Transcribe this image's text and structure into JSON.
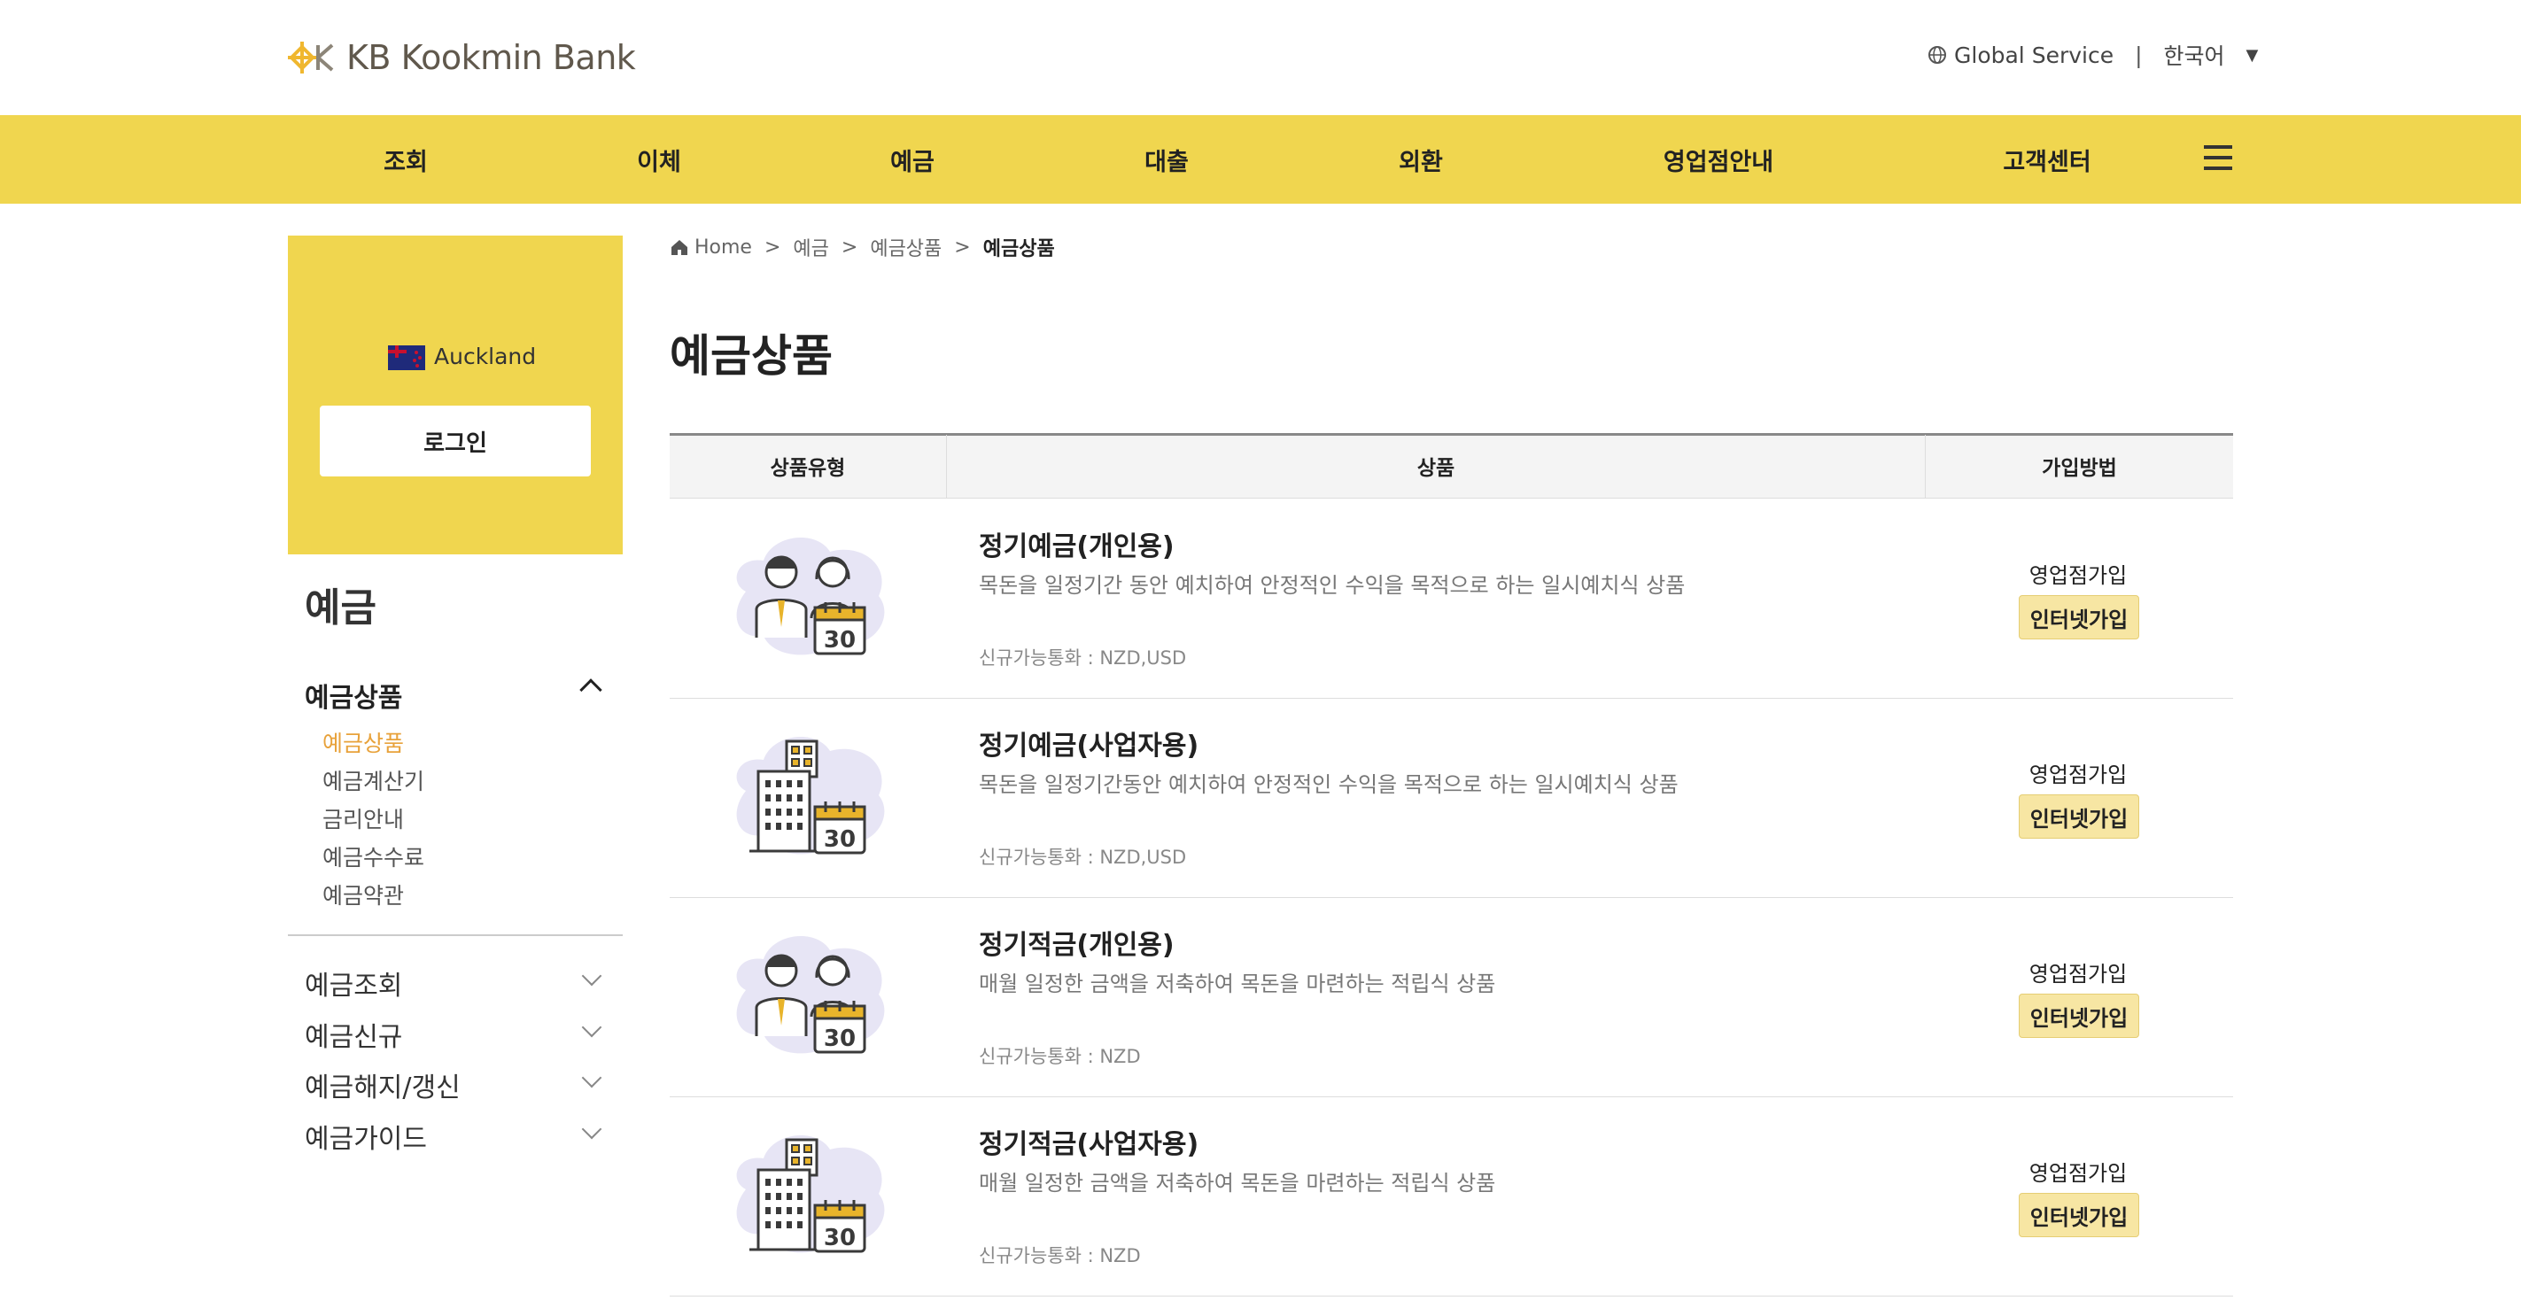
{
  "header": {
    "brand": "KB Kookmin Bank",
    "global_service": "Global Service",
    "divider": "|",
    "language": "한국어",
    "language_caret": "▼"
  },
  "nav": {
    "items": [
      "조회",
      "이체",
      "예금",
      "대출",
      "외환",
      "영업점안내",
      "고객센터"
    ]
  },
  "left_panel": {
    "city": "Auckland",
    "login_label": "로그인",
    "section_title": "예금",
    "open_group": "예금상품",
    "sub_items": [
      "예금상품",
      "예금계산기",
      "금리안내",
      "예금수수료",
      "예금약관"
    ],
    "collapsed_groups": [
      "예금조회",
      "예금신규",
      "예금해지/갱신",
      "예금가이드"
    ]
  },
  "breadcrumb": {
    "home": "Home",
    "sep": ">",
    "level1": "예금",
    "level2": "예금상품",
    "current": "예금상품"
  },
  "page_title": "예금상품",
  "table": {
    "headers": [
      "상품유형",
      "상품",
      "가입방법"
    ],
    "rows": [
      {
        "icon": "people-calendar-icon",
        "name": "정기예금(개인용)",
        "desc": "목돈을 일정기간 동안 예치하여 안정적인 수익을 목적으로 하는 일시예치식 상품",
        "currency": "신규가능통화 : NZD,USD",
        "branch": "영업점가입",
        "internet": "인터넷가입",
        "calendar_num": "30"
      },
      {
        "icon": "building-calendar-icon",
        "name": "정기예금(사업자용)",
        "desc": "목돈을 일정기간동안 예치하여 안정적인 수익을 목적으로 하는 일시예치식 상품",
        "currency": "신규가능통화 : NZD,USD",
        "branch": "영업점가입",
        "internet": "인터넷가입",
        "calendar_num": "30"
      },
      {
        "icon": "people-calendar-icon",
        "name": "정기적금(개인용)",
        "desc": "매월 일정한 금액을 저축하여 목돈을 마련하는 적립식 상품",
        "currency": "신규가능통화 : NZD",
        "branch": "영업점가입",
        "internet": "인터넷가입",
        "calendar_num": "30"
      },
      {
        "icon": "building-calendar-icon",
        "name": "정기적금(사업자용)",
        "desc": "매월 일정한 금액을 저축하여 목돈을 마련하는 적립식 상품",
        "currency": "신규가능통화 : NZD",
        "branch": "영업점가입",
        "internet": "인터넷가입",
        "calendar_num": "30"
      }
    ]
  },
  "colors": {
    "brand_yellow": "#f0d64f",
    "active_orange": "#e8a23b",
    "button_yellow": "#f7e6a3"
  }
}
